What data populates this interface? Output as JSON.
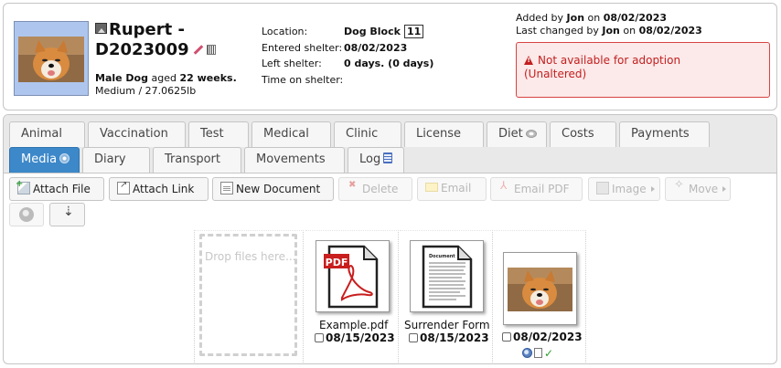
{
  "animal": {
    "name": "Rupert -",
    "code": "D2023009",
    "sex_species": "Male Dog",
    "aged_word": "aged",
    "age": "22 weeks.",
    "size_weight": "Medium / 27.0625lb"
  },
  "shelter": {
    "location_label": "Location:",
    "location_value": "Dog Block",
    "location_unit": "11",
    "entered_label": "Entered shelter:",
    "entered_value": "08/02/2023",
    "left_label": "Left shelter:",
    "left_value": "",
    "time_label": "Time on shelter:",
    "time_value": "0 days. (0 days)"
  },
  "audit": {
    "added_prefix": "Added by",
    "added_user": "Jon",
    "added_on": "on",
    "added_date": "08/02/2023",
    "changed_prefix": "Last changed by",
    "changed_user": "Jon",
    "changed_on": "on",
    "changed_date": "08/02/2023"
  },
  "alert": {
    "line1": "Not available for adoption",
    "line2": "(Unaltered)",
    "color": "#c21f1f"
  },
  "tabs": {
    "animal": "Animal",
    "vaccination": "Vaccination",
    "test": "Test",
    "medical": "Medical",
    "clinic": "Clinic",
    "license": "License",
    "diet": "Diet",
    "costs": "Costs",
    "payments": "Payments",
    "media": "Media",
    "diary": "Diary",
    "transport": "Transport",
    "movements": "Movements",
    "log": "Log",
    "active_color": "#3d88c9"
  },
  "toolbar": {
    "attach_file": "Attach File",
    "attach_link": "Attach Link",
    "new_document": "New Document",
    "delete": "Delete",
    "email": "Email",
    "email_pdf": "Email PDF",
    "image": "Image",
    "move": "Move"
  },
  "media": {
    "drop_text": "Drop files here...",
    "items": [
      {
        "caption": "Example.pdf",
        "date": "08/15/2023",
        "icon": "pdf-icon"
      },
      {
        "caption": "Surrender Form",
        "date": "08/15/2023",
        "icon": "document-icon"
      },
      {
        "caption": "",
        "date": "08/02/2023",
        "icon": "dog-photo"
      }
    ]
  }
}
